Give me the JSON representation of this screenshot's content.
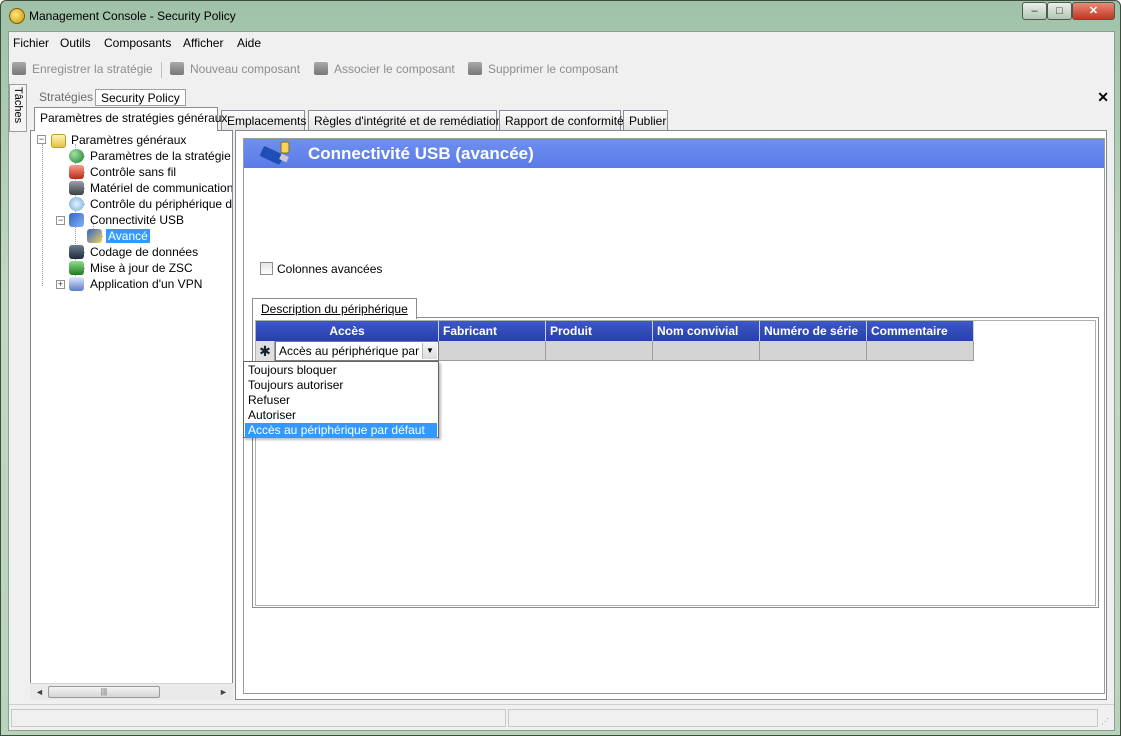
{
  "window": {
    "title": "Management Console  - Security Policy",
    "buttons": {
      "minimize": "–",
      "maximize": "□",
      "close": "✕"
    }
  },
  "menu": [
    "Fichier",
    "Outils",
    "Composants",
    "Afficher",
    "Aide"
  ],
  "toolbar": {
    "save": "Enregistrer la stratégie",
    "new_component": "Nouveau composant",
    "associate": "Associer le composant",
    "delete": "Supprimer le composant"
  },
  "side_tab": "Tâches",
  "doc_tabs": [
    "Stratégies",
    "Security Policy"
  ],
  "main_tabs": [
    "Paramètres de stratégies généraux",
    "Emplacements",
    "Règles d'intégrité et de remédiation",
    "Rapport de conformité",
    "Publier"
  ],
  "tree": {
    "root": "Paramètres généraux",
    "items": [
      "Paramètres de la stratégie",
      "Contrôle sans fil",
      "Matériel de communication",
      "Contrôle du périphérique d",
      "Connectivité USB",
      "Avancé",
      "Codage de données",
      "Mise à jour de ZSC",
      "Application d'un VPN"
    ]
  },
  "panel": {
    "title": "Connectivité USB (avancée)",
    "checkbox_label": "Colonnes avancées",
    "subtab": "Description du périphérique",
    "columns": [
      "Accès",
      "Fabricant",
      "Produit",
      "Nom convivial",
      "Numéro de série",
      "Commentaire"
    ],
    "row_marker": "✱",
    "combo_value": "Accès au périphérique par",
    "dropdown": [
      "Toujours bloquer",
      "Toujours autoriser",
      "Refuser",
      "Autoriser",
      "Accès au périphérique par défaut"
    ]
  },
  "colors": {
    "header_band": "#5a7be6",
    "grid_header": "#2740a8",
    "selection": "#3399ff"
  }
}
